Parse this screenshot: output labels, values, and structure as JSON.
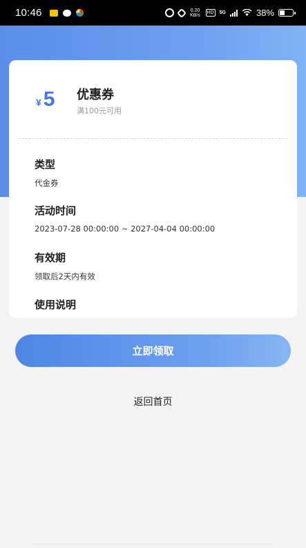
{
  "status_bar": {
    "time": "10:46",
    "net_speed_top": "0.20",
    "net_speed_unit": "KB/s",
    "hd": "HD",
    "signal_type": "5G",
    "battery": "38%"
  },
  "coupon": {
    "currency": "¥",
    "amount": "5",
    "title": "优惠券",
    "condition": "满100元可用"
  },
  "details": {
    "type_label": "类型",
    "type_value": "代金券",
    "time_label": "活动时间",
    "time_value": "2023-07-28 00:00:00 ~ 2027-04-04 00:00:00",
    "validity_label": "有效期",
    "validity_value": "领取后2天内有效",
    "usage_label": "使用说明"
  },
  "actions": {
    "claim_label": "立即领取",
    "back_label": "返回首页"
  },
  "colors": {
    "accent": "#4f86e6",
    "header_bg": "#6c9ef0",
    "page_bg": "#f4f4f5"
  }
}
